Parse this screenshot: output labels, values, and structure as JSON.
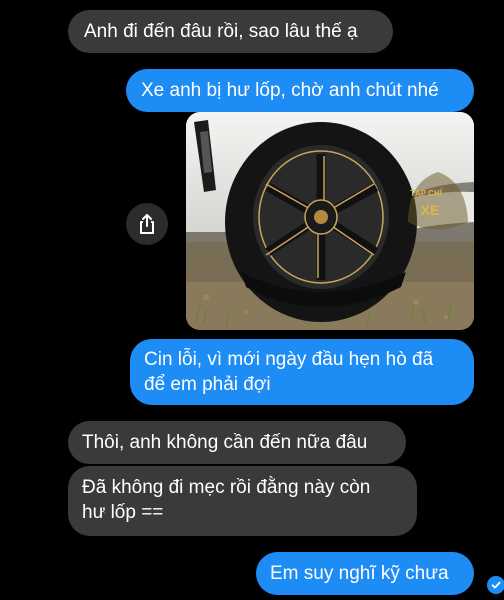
{
  "messages": [
    {
      "id": "m1",
      "direction": "incoming",
      "text": "Anh đi đến đâu rồi, sao lâu thế ạ"
    },
    {
      "id": "m2",
      "direction": "outgoing",
      "text_before": "Xe anh bị ",
      "text_struck": "hư",
      "text_after": " lốp, chờ anh chút nhé"
    },
    {
      "id": "m3",
      "direction": "outgoing",
      "type": "image",
      "alt": "Photo of a white car with a flat tyre"
    },
    {
      "id": "m4",
      "direction": "outgoing",
      "lines": [
        "Cin lỗi, vì mới ngày đầu hẹn hò đã",
        "để em phải đợi"
      ]
    },
    {
      "id": "m5",
      "direction": "incoming",
      "text": "Thôi, anh không cần đến nữa đâu"
    },
    {
      "id": "m6",
      "direction": "incoming",
      "line1": "Đã không đi mẹc rồi đằng này còn",
      "line2_struck": "hư",
      "line2_after": " lốp =="
    },
    {
      "id": "m7",
      "direction": "outgoing",
      "text": "Em suy nghĩ kỹ chưa"
    }
  ],
  "watermark": {
    "line1": "TẠP CHÍ",
    "line2": "XE"
  },
  "icons": {
    "share": "share-icon",
    "read_receipt": "check-icon"
  },
  "colors": {
    "background": "#000000",
    "incoming_bubble": "#3a3a3c",
    "outgoing_bubble": "#1e8cf5",
    "text": "#ffffff",
    "strike_mark": "#e5484d"
  }
}
